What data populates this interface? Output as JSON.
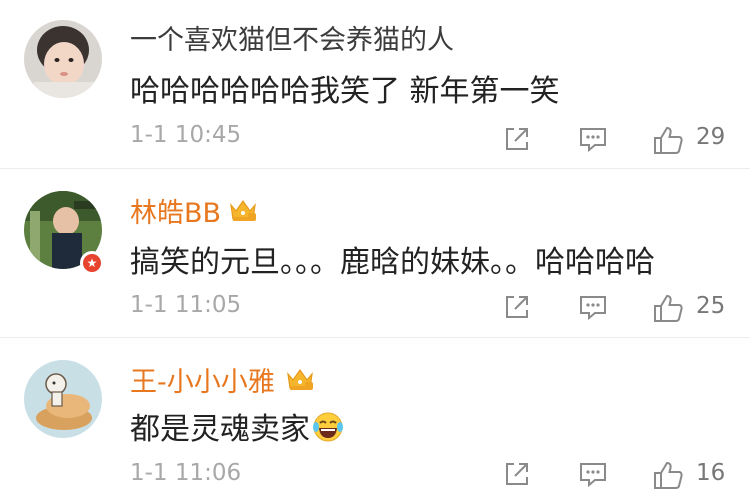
{
  "comments": [
    {
      "username": "一个喜欢猫但不会养猫的人",
      "verified": false,
      "text": "哈哈哈哈哈哈我笑了 新年第一笑",
      "time": "1-1 10:45",
      "likes": "29",
      "avatar_icon": "baby-photo"
    },
    {
      "username": "林皓BB",
      "verified": true,
      "text": "搞笑的元旦。。。鹿晗的妹妹。。哈哈哈哈",
      "time": "1-1 11:05",
      "likes": "25",
      "avatar_icon": "child-photo"
    },
    {
      "username": "王-小小小雅",
      "verified": false,
      "text": "都是灵魂卖家",
      "emoji": "laughing-tears-emoji",
      "time": "1-1 11:06",
      "likes": "16",
      "avatar_icon": "cartoon-illustration"
    }
  ],
  "colors": {
    "vip_name": "#e8781f",
    "regular_name": "#3c3c3c",
    "meta": "#a8a8a8",
    "crown": "#f5b62e",
    "verified": "#e6442e"
  },
  "icons": {
    "share": "share-icon",
    "reply": "reply-icon",
    "like": "thumbs-up-icon",
    "crown": "vip-crown-icon"
  }
}
